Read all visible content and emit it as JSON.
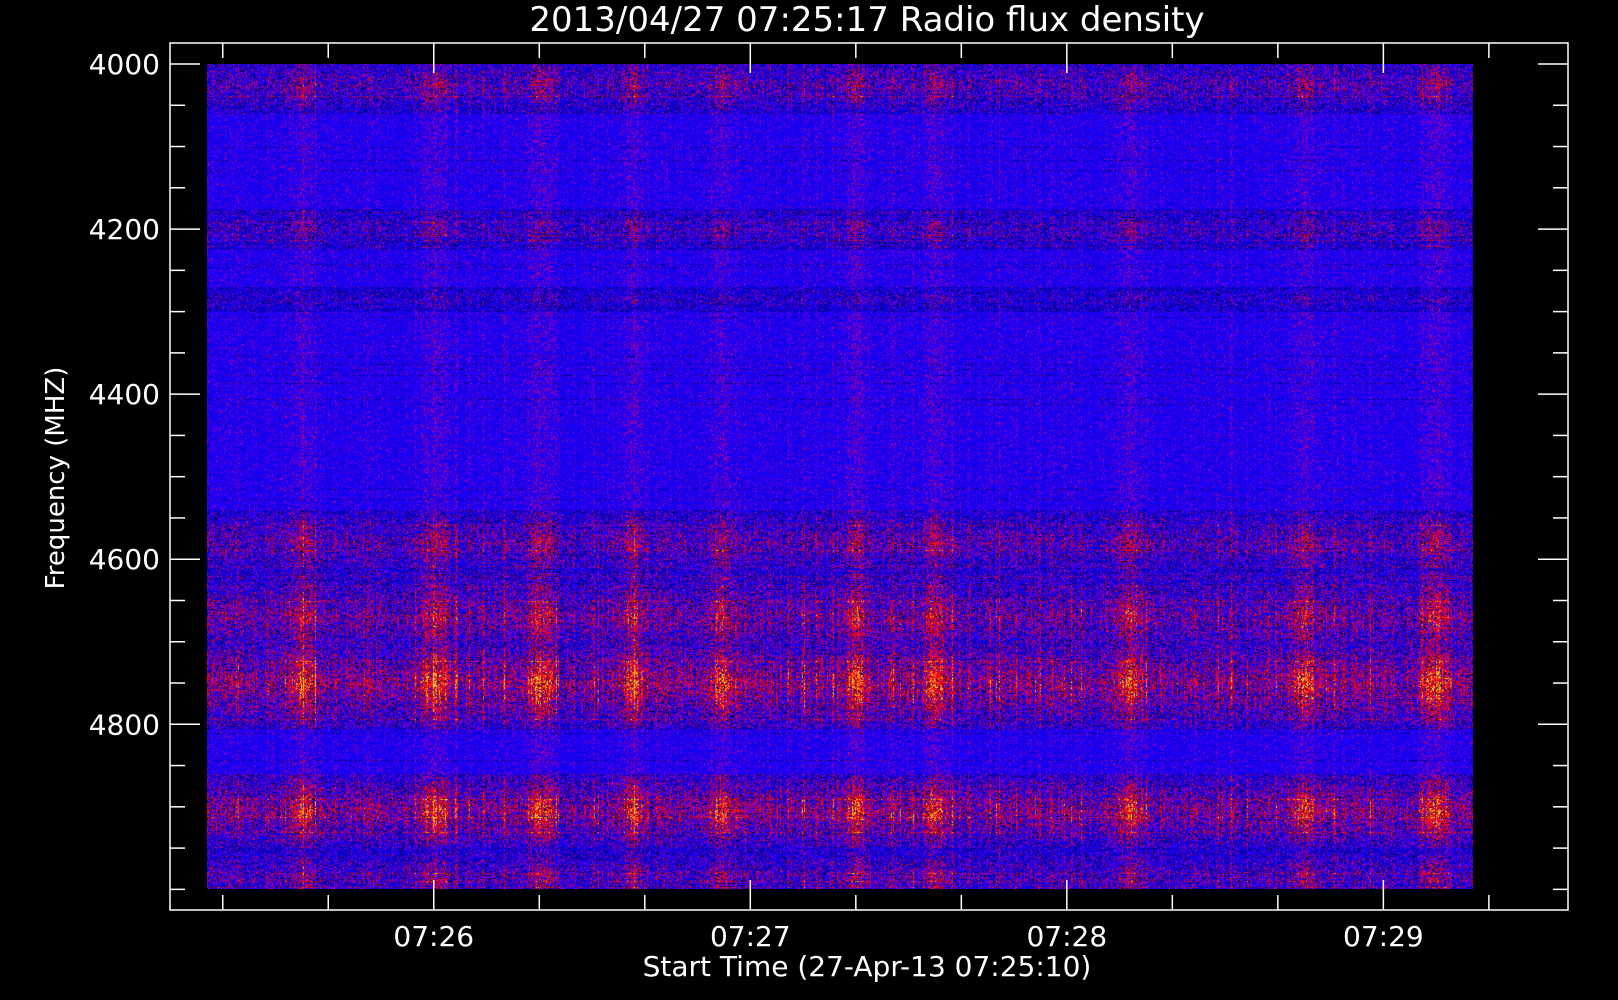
{
  "chart_data": {
    "type": "heatmap",
    "title": "2013/04/27 07:25:17 Radio flux density",
    "xlabel": "Start Time (27-Apr-13 07:25:10)",
    "ylabel": "Frequency (MHZ)",
    "x_range": [
      "07:25:10",
      "07:29:35"
    ],
    "x_data_range": [
      "07:25:17",
      "07:29:17"
    ],
    "y_range": [
      4000,
      5025
    ],
    "y_data_range": [
      4000,
      5000
    ],
    "y_reversed": true,
    "x_major_ticks": [
      "07:26",
      "07:27",
      "07:28",
      "07:29"
    ],
    "y_major_ticks": [
      4000,
      4200,
      4400,
      4600,
      4800
    ],
    "y_minor_step": 50,
    "x_minor_step_seconds": 20,
    "colormap": [
      "#000000",
      "#1a00c8",
      "#0000ff",
      "#c00000",
      "#ff2a00",
      "#ffd000"
    ],
    "background_color": "#000000",
    "frame_color": "#ffffff",
    "features": {
      "bright_bands_mhz": [
        {
          "center": 4025,
          "width": 35,
          "level": 0.45
        },
        {
          "center": 4200,
          "width": 25,
          "level": 0.35
        },
        {
          "center": 4285,
          "width": 15,
          "level": 0.25
        },
        {
          "center": 4580,
          "width": 40,
          "level": 0.5
        },
        {
          "center": 4670,
          "width": 50,
          "level": 0.6
        },
        {
          "center": 4750,
          "width": 55,
          "level": 0.75
        },
        {
          "center": 4905,
          "width": 45,
          "level": 0.7
        },
        {
          "center": 4985,
          "width": 35,
          "level": 0.45
        }
      ],
      "burst_columns_time": [
        "07:25:35",
        "07:26:00",
        "07:26:20",
        "07:26:38",
        "07:26:55",
        "07:27:20",
        "07:27:35",
        "07:28:12",
        "07:28:45",
        "07:29:10"
      ]
    }
  }
}
